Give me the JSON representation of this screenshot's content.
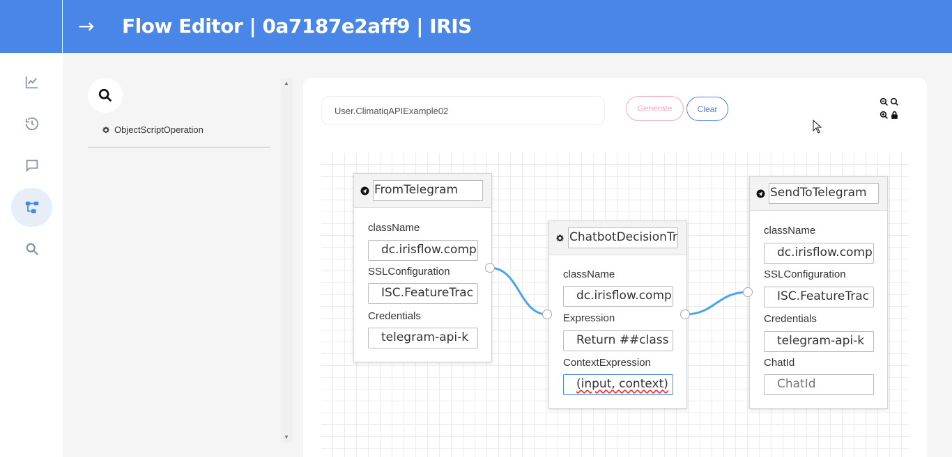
{
  "header": {
    "nav_arrow": "→",
    "title": "Flow Editor | 0a7187e2aff9 | IRIS"
  },
  "sidebar": {
    "items": [
      {
        "name": "analytics",
        "icon": "chart-line-icon"
      },
      {
        "name": "history",
        "icon": "history-icon"
      },
      {
        "name": "chat",
        "icon": "chat-bubble-icon"
      },
      {
        "name": "flow",
        "icon": "flow-tree-icon",
        "active": true
      },
      {
        "name": "search",
        "icon": "search-icon"
      }
    ]
  },
  "palette": {
    "search_icon": "search-icon",
    "items": [
      {
        "label": "ObjectScriptOperation",
        "icon": "gear-icon"
      }
    ]
  },
  "toolbar": {
    "flow_name": "User.ClimatiqAPIExample02",
    "generate_label": "Generate",
    "clear_label": "Clear",
    "zoom_icons": [
      "zoom-out-icon",
      "zoom-in-icon",
      "zoom-reset-icon",
      "lock-icon"
    ]
  },
  "nodes": [
    {
      "id": "from-telegram",
      "icon": "telegram-icon",
      "title": "FromTelegram",
      "fields": [
        {
          "label": "className",
          "value": "dc.irisflow.comp"
        },
        {
          "label": "SSLConfiguration",
          "value": "ISC.FeatureTrac"
        },
        {
          "label": "Credentials",
          "value": "telegram-api-k"
        }
      ]
    },
    {
      "id": "chatbot-decision",
      "icon": "gear-icon",
      "title": "ChatbotDecisionTre",
      "fields": [
        {
          "label": "className",
          "value": "dc.irisflow.comp"
        },
        {
          "label": "Expression",
          "value": "Return ##class"
        },
        {
          "label": "ContextExpression",
          "value": "(input, context)"
        }
      ]
    },
    {
      "id": "send-to-telegram",
      "icon": "telegram-icon",
      "title": "SendToTelegram",
      "fields": [
        {
          "label": "className",
          "value": "dc.irisflow.comp"
        },
        {
          "label": "SSLConfiguration",
          "value": "ISC.FeatureTrac"
        },
        {
          "label": "Credentials",
          "value": "telegram-api-k"
        },
        {
          "label": "ChatId",
          "placeholder": "ChatId"
        }
      ]
    }
  ],
  "colors": {
    "header": "#4a86e8",
    "connection": "#4aa3f0",
    "generate": "#f4a7c4",
    "clear": "#4a86e8"
  }
}
